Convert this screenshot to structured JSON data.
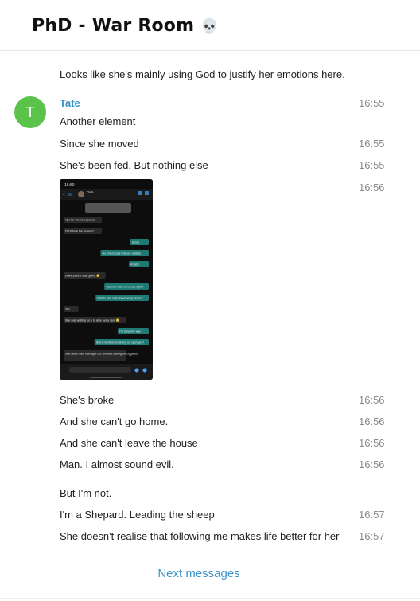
{
  "chat": {
    "title": "PhD - War Room",
    "title_emoji": "💀"
  },
  "messages": [
    {
      "text": "Looks like she's mainly using God to justify her emotions here.",
      "time": ""
    },
    {
      "sender": "Tate",
      "avatar_letter": "T",
      "text": "Another element",
      "time": "16:55"
    },
    {
      "text": "Since she moved",
      "time": "16:55"
    },
    {
      "text": "She's been fed. But nothing else",
      "time": "16:55"
    },
    {
      "type": "image",
      "time": "16:56"
    },
    {
      "text": "She's broke",
      "time": "16:56"
    },
    {
      "text": "And she can't go home.",
      "time": "16:56"
    },
    {
      "text": "And she can't leave the house",
      "time": "16:56"
    },
    {
      "text": "Man. I almost sound evil.",
      "time": "16:56"
    },
    {
      "text": "But I'm not.",
      "time": ""
    },
    {
      "text": "I'm a Shepard. Leading the sheep",
      "time": "16:57"
    },
    {
      "text": "She doesn't realise that following me makes life better for her",
      "time": "16:57"
    }
  ],
  "screenshot": {
    "status_time": "15:50",
    "contact_name": "Gen",
    "back_count": "104",
    "lines": [
      {
        "side": "in",
        "text": "Vpn for the new phones"
      },
      {
        "side": "in",
        "text": "Did it took the money?"
      },
      {
        "side": "out",
        "text": "Sures."
      },
      {
        "side": "out",
        "text": "Go check cars that are outside"
      },
      {
        "side": "out",
        "text": "At albs"
      },
      {
        "side": "in",
        "text": "Doing phone then going 😊"
      },
      {
        "side": "out",
        "text": "Yasmine has no money right?"
      },
      {
        "side": "out",
        "text": "What's she said about being broke?"
      },
      {
        "side": "in",
        "text": "Yes"
      },
      {
        "side": "in",
        "text": "She was waiting for u to give her a card 😂"
      },
      {
        "side": "out",
        "text": "I'm sure she was"
      },
      {
        "side": "out",
        "text": "She's mentioned having no cash yes?"
      },
      {
        "side": "in",
        "text": "She hasnt said it straight but she was asking for ciggarets"
      }
    ]
  },
  "footer": {
    "next_label": "Next messages"
  },
  "colors": {
    "sender": "#3a93c9",
    "avatar": "#5cc34a",
    "out_bubble": "#1f7a74",
    "in_bubble": "#2a2a2a"
  }
}
